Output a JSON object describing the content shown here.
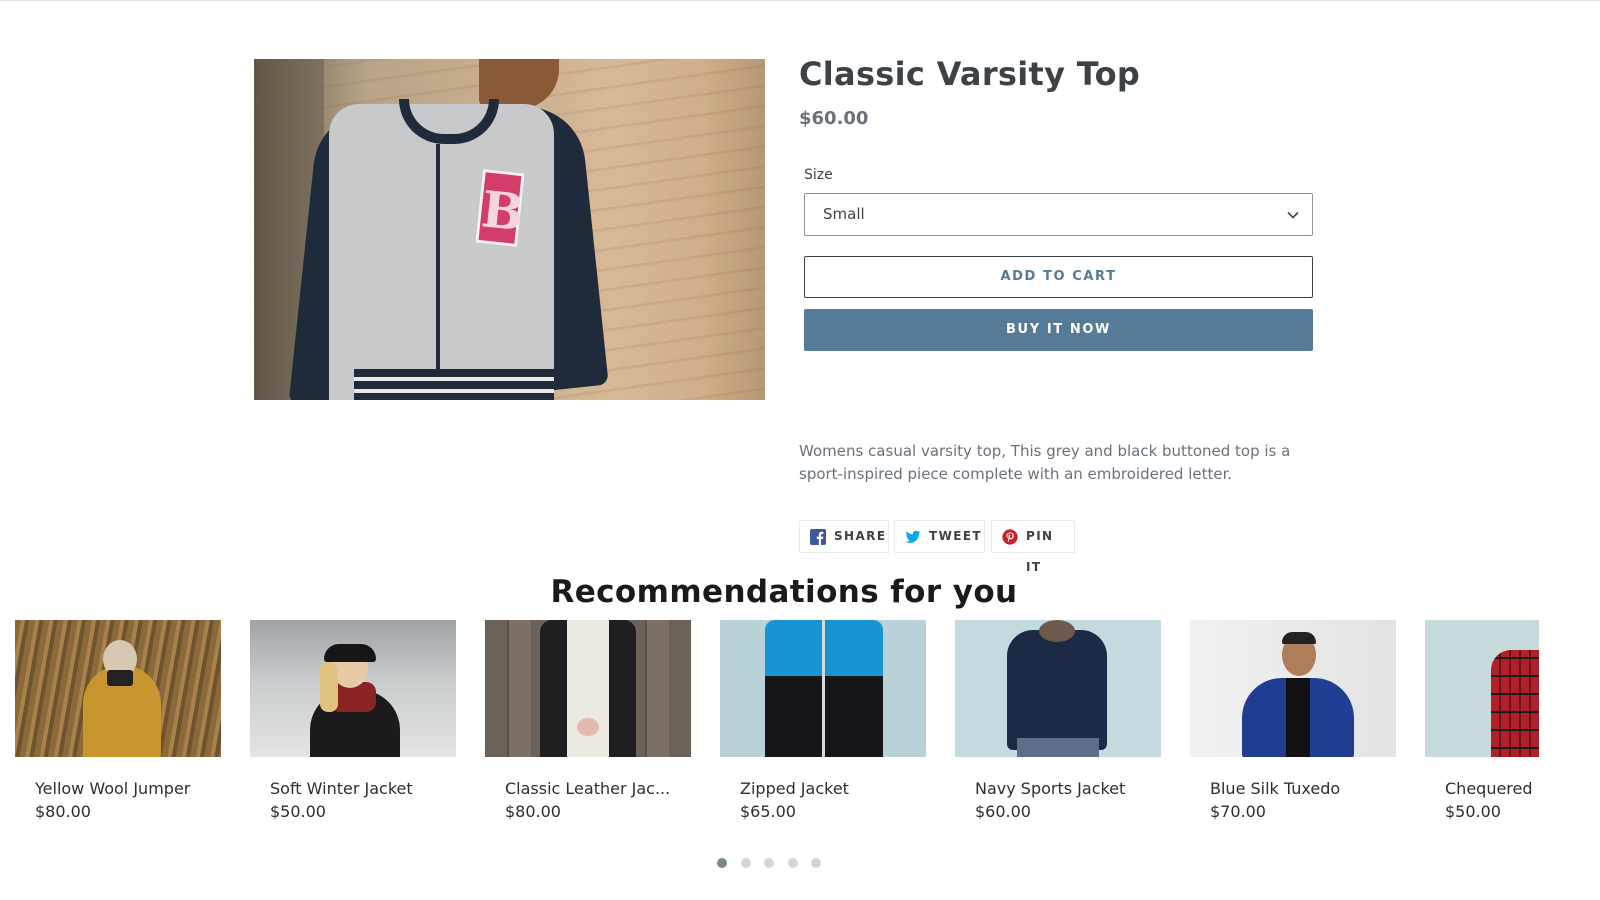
{
  "product": {
    "title": "Classic Varsity Top",
    "price": "$60.00",
    "image_icon": "varsity-jacket-photo",
    "size_label": "Size",
    "size_value": "Small",
    "add_to_cart_label": "ADD TO CART",
    "buy_now_label": "BUY IT NOW",
    "description": "Womens casual varsity top, This grey and black buttoned top is a sport-inspired piece complete with an embroidered letter.",
    "letter": "B",
    "accent_color": "#557b97"
  },
  "share": {
    "buttons": [
      {
        "label": "SHARE",
        "icon": "facebook-icon",
        "color": "#3b5998"
      },
      {
        "label": "TWEET",
        "icon": "twitter-icon",
        "color": "#00aced"
      },
      {
        "label": "PIN IT",
        "icon": "pinterest-icon",
        "color": "#cb2027"
      }
    ]
  },
  "recommendations": {
    "title": "Recommendations for you",
    "items": [
      {
        "name": "Yellow Wool Jumper",
        "price": "$80.00"
      },
      {
        "name": "Soft Winter Jacket",
        "price": "$50.00"
      },
      {
        "name": "Classic Leather Jac...",
        "price": "$80.00"
      },
      {
        "name": "Zipped Jacket",
        "price": "$65.00"
      },
      {
        "name": "Navy Sports Jacket",
        "price": "$60.00"
      },
      {
        "name": "Blue Silk Tuxedo",
        "price": "$70.00"
      },
      {
        "name": "Chequered",
        "price": "$50.00"
      }
    ],
    "pages": 5,
    "active_page": 1
  }
}
